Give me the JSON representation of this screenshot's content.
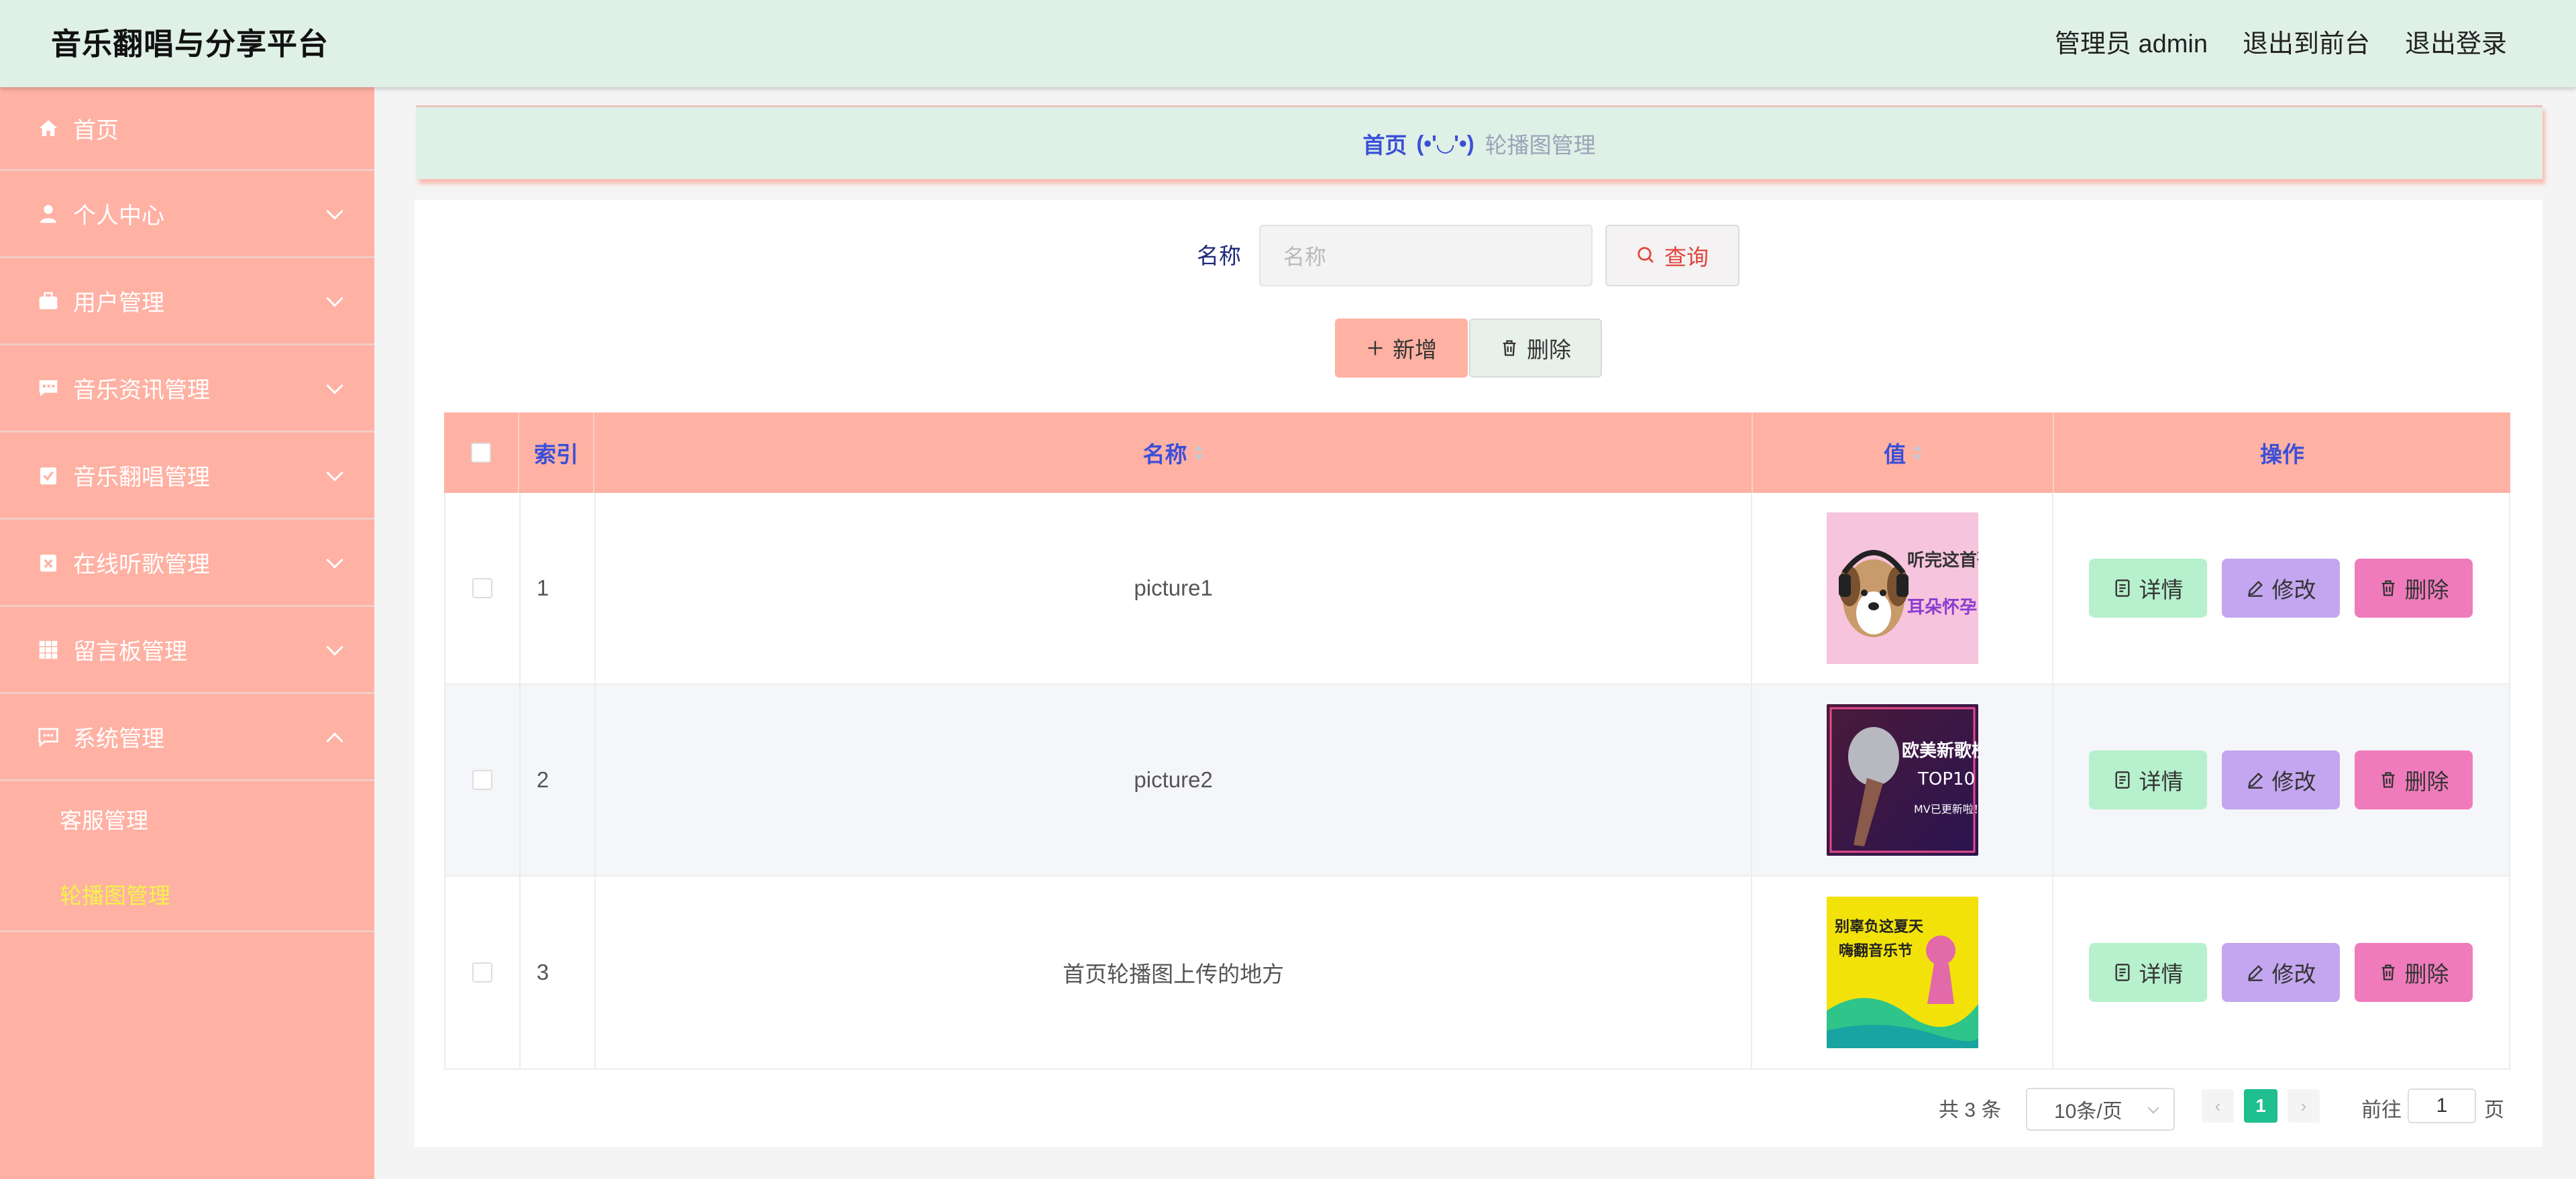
{
  "header": {
    "app_title": "音乐翻唱与分享平台",
    "links": [
      "管理员 admin",
      "退出到前台",
      "退出登录"
    ]
  },
  "sidebar": {
    "items": [
      {
        "label": "首页",
        "icon": "home-icon"
      },
      {
        "label": "个人中心",
        "icon": "user-icon"
      },
      {
        "label": "用户管理",
        "icon": "briefcase-icon"
      },
      {
        "label": "音乐资讯管理",
        "icon": "chat-icon"
      },
      {
        "label": "音乐翻唱管理",
        "icon": "clipboard-check-icon"
      },
      {
        "label": "在线听歌管理",
        "icon": "clipboard-x-icon"
      },
      {
        "label": "留言板管理",
        "icon": "grid-icon"
      },
      {
        "label": "系统管理",
        "icon": "chat-dots-icon"
      }
    ],
    "submenu": [
      {
        "label": "客服管理",
        "active": false
      },
      {
        "label": "轮播图管理",
        "active": true
      }
    ]
  },
  "breadcrumb": {
    "home": "首页",
    "separator": "(•'◡'•)",
    "current": "轮播图管理"
  },
  "search": {
    "label": "名称",
    "placeholder": "名称",
    "query_button": "查询"
  },
  "actions": {
    "add": "新增",
    "delete": "删除"
  },
  "table": {
    "columns": [
      "索引",
      "名称",
      "值",
      "操作"
    ],
    "rows": [
      {
        "index": "1",
        "name": "picture1",
        "thumb": "dog-with-headphones"
      },
      {
        "index": "2",
        "name": "picture2",
        "thumb": "microphone-top10"
      },
      {
        "index": "3",
        "name": "首页轮播图上传的地方",
        "thumb": "summer-music-festival"
      }
    ],
    "row_actions": {
      "detail": "详情",
      "edit": "修改",
      "delete": "删除"
    }
  },
  "thumb_text": {
    "t1a": "听完这首歌",
    "t1b": "耳朵怀孕了",
    "t2a": "欧美新歌榜",
    "t2b": "TOP10",
    "t2c": "MV已更新啦！",
    "t3a": "别辜负这夏天",
    "t3b": "嗨翻音乐节"
  },
  "pagination": {
    "total": "共 3 条",
    "page_size": "10条/页",
    "current_page": "1",
    "goto_label": "前往",
    "goto_value": "1",
    "goto_unit": "页"
  },
  "colors": {
    "header_bg": "#dff0e7",
    "sidebar_bg": "#ffb1a3",
    "active_sub": "#f3f348",
    "table_head": "#ffb1a3",
    "accent_blue": "#3a4fd8",
    "detail_btn": "#b6f0cc",
    "edit_btn": "#c3a6ef",
    "delete_btn": "#f07bbc",
    "page_active": "#1fbf8f"
  }
}
